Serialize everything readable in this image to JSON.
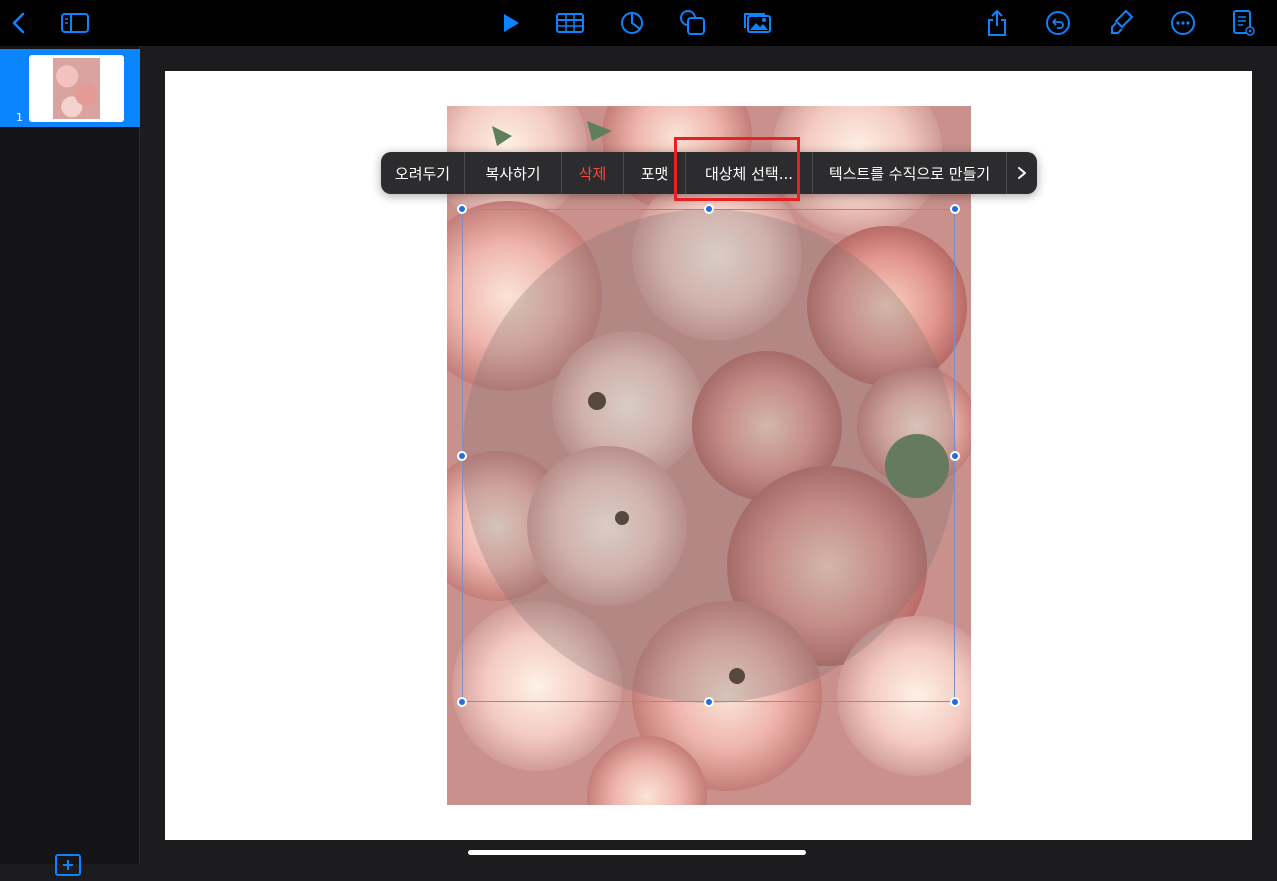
{
  "colors": {
    "accent": "#0a84ff",
    "destructive": "#ff453a",
    "highlight": "#e8201f"
  },
  "toolbar": {
    "left_icons": [
      "back-chevron-icon",
      "sidebar-toggle-icon"
    ],
    "center_icons": [
      "play-icon",
      "table-icon",
      "chart-icon",
      "shape-icon",
      "media-icon"
    ],
    "right_icons": [
      "share-icon",
      "undo-icon",
      "format-brush-icon",
      "more-icon",
      "document-icon"
    ]
  },
  "sidebar": {
    "slides": [
      {
        "number": "1",
        "selected": true
      }
    ],
    "add_slide_icon": "add-slide-icon"
  },
  "context_menu": {
    "items": [
      {
        "label": "오려두기"
      },
      {
        "label": "복사하기"
      },
      {
        "label": "삭제"
      },
      {
        "label": "포맷"
      },
      {
        "label": "대상체 선택..."
      },
      {
        "label": "텍스트를 수직으로 만들기"
      }
    ],
    "more_icon": "chevron-right-icon"
  }
}
